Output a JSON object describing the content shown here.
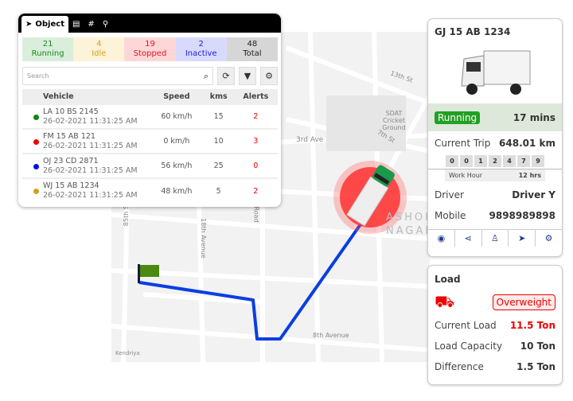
{
  "panel": {
    "tabs": [
      {
        "label": "Object",
        "icon": "navigation-arrow-icon"
      },
      {
        "icon": "clipboard-icon"
      },
      {
        "icon": "railway-icon"
      },
      {
        "icon": "map-pin-network-icon"
      }
    ],
    "stats": [
      {
        "count": "21",
        "label": "Running",
        "color": "#1a8a1a",
        "bg": "#d9eedb"
      },
      {
        "count": "4",
        "label": "Idle",
        "color": "#d4a017",
        "bg": "#fdf3d8"
      },
      {
        "count": "19",
        "label": "Stopped",
        "color": "#e8101a",
        "bg": "#fdd7d8"
      },
      {
        "count": "2",
        "label": "Inactive",
        "color": "#1a1ae8",
        "bg": "#d8dafc"
      },
      {
        "count": "48",
        "label": "Total",
        "color": "#222",
        "bg": "#d6d6d6"
      }
    ],
    "search_placeholder": "Search",
    "columns": [
      "Vehicle",
      "Speed",
      "kms",
      "Alerts"
    ],
    "rows": [
      {
        "vehicle": "LA 10 BS 2145",
        "time": "26-02-2021 11:31:25 AM",
        "speed": "60 km/h",
        "kms": "15",
        "alerts": "2",
        "color": "#0a8a0a"
      },
      {
        "vehicle": "FM 15 AB 121",
        "time": "26-02-2021 11:31:25 AM",
        "speed": "0 km/h",
        "kms": "10",
        "alerts": "3",
        "color": "#f00000"
      },
      {
        "vehicle": "OJ 23 CD 2871",
        "time": "26-02-2021 11:31:25 AM",
        "speed": "56 km/h",
        "kms": "25",
        "alerts": "0",
        "color": "#0010f0"
      },
      {
        "vehicle": "WJ 15 AB 1234",
        "time": "26-02-2021 11:31:25 AM",
        "speed": "48 km/h",
        "kms": "5",
        "alerts": "2",
        "color": "#d4a017"
      }
    ]
  },
  "map": {
    "labels": [
      "13th St",
      "SDAT Cricket Ground",
      "7th St",
      "3rd Ave",
      "ASHOK NAGAR",
      "85th St",
      "18th Avenue",
      "Road",
      "8th Avenue",
      "Kendriya"
    ],
    "route_color": "#0a3fe0"
  },
  "vehicle_card": {
    "plate": "GJ 15 AB 1234",
    "status": "Running",
    "duration": "17 mins",
    "trip_label": "Current Trip",
    "trip_value": "648.01 km",
    "odometer": [
      "0",
      "0",
      "1",
      "2",
      "4",
      "7",
      "9"
    ],
    "work_label": "Work Hour",
    "work_value": "12 hrs",
    "driver_label": "Driver",
    "driver_value": "Driver Y",
    "mobile_label": "Mobile",
    "mobile_value": "9898989898",
    "actions": [
      "eye-icon",
      "share-icon",
      "network-icon",
      "navigate-icon",
      "settings-search-icon"
    ]
  },
  "load_card": {
    "title": "Load",
    "badge": "Overweight",
    "current_label": "Current Load",
    "current_value": "11.5 Ton",
    "capacity_label": "Load Capacity",
    "capacity_value": "10 Ton",
    "diff_label": "Difference",
    "diff_value": "1.5 Ton"
  }
}
